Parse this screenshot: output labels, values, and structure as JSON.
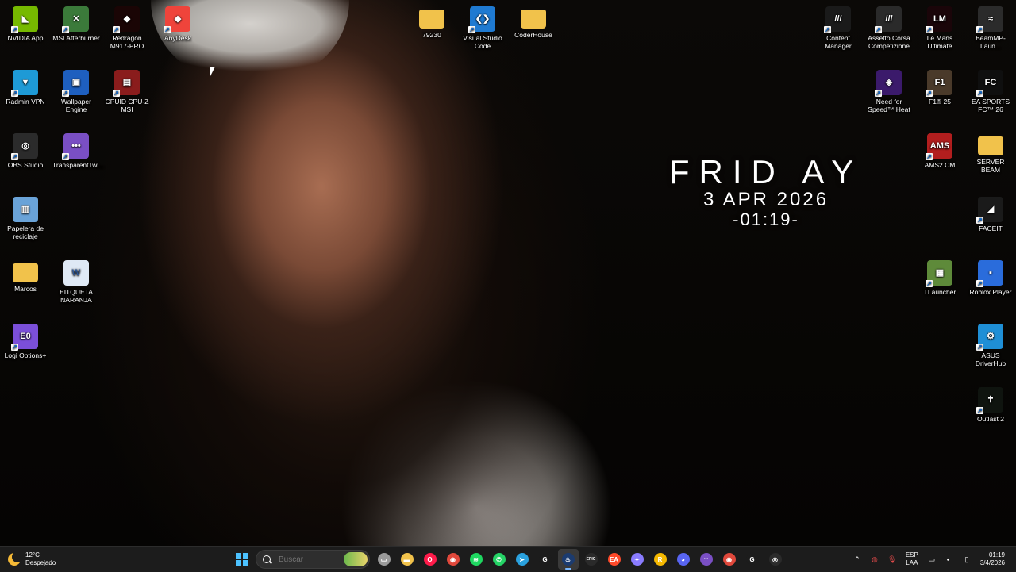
{
  "desktop": {
    "left_icons": [
      {
        "label": "NVIDIA App",
        "icon": "nvidia-icon",
        "color": "#76b900",
        "glyph": "◣"
      },
      {
        "label": "MSI Afterburner",
        "icon": "msi-afterburner-icon",
        "color": "#3b7a3a",
        "glyph": "✕"
      },
      {
        "label": "Redragon M917-PRO",
        "icon": "redragon-icon",
        "color": "#1a0505",
        "glyph": "◆"
      },
      {
        "label": "AnyDesk",
        "icon": "anydesk-icon",
        "color": "#ef443b",
        "glyph": "◆"
      },
      {
        "label": "Radmin VPN",
        "icon": "radmin-vpn-icon",
        "color": "#1e9ad6",
        "glyph": "▼"
      },
      {
        "label": "Wallpaper Engine",
        "icon": "wallpaper-engine-icon",
        "color": "#1e5fbf",
        "glyph": "▣"
      },
      {
        "label": "CPUID CPU-Z MSI",
        "icon": "cpuz-icon",
        "color": "#8a1c1c",
        "glyph": "▤"
      },
      {
        "label": "OBS Studio",
        "icon": "obs-icon",
        "color": "#2b2b2b",
        "glyph": "◎"
      },
      {
        "label": "TransparentTwi...",
        "icon": "transparent-twitch-icon",
        "color": "#7a4fc4",
        "glyph": "•••"
      },
      {
        "label": "Papelera de reciclaje",
        "icon": "recycle-bin-icon",
        "color": "#6aa3d8",
        "glyph": "▥"
      },
      {
        "label": "Marcos",
        "icon": "folder-icon",
        "color": "#f1c24b",
        "glyph": ""
      },
      {
        "label": "EITQUETA NARANJA",
        "icon": "word-document-icon",
        "color": "#dfe9f5",
        "glyph": "W"
      },
      {
        "label": "Logi Options+",
        "icon": "logi-options-icon",
        "color": "#7b4fd9",
        "glyph": "E0"
      }
    ],
    "top_icons": [
      {
        "label": "79230",
        "icon": "folder-icon",
        "color": "#f1c24b",
        "glyph": ""
      },
      {
        "label": "Visual Studio Code",
        "icon": "vscode-icon",
        "color": "#1f7ad1",
        "glyph": "❮❯"
      },
      {
        "label": "CoderHouse",
        "icon": "folder-icon",
        "color": "#f1c24b",
        "glyph": ""
      }
    ],
    "right_icons": [
      {
        "label": "Content Manager",
        "icon": "content-manager-icon",
        "color": "#1a1a1a",
        "glyph": "///"
      },
      {
        "label": "Assetto Corsa Competizione",
        "icon": "acc-icon",
        "color": "#2a2a2a",
        "glyph": "///"
      },
      {
        "label": "Le Mans Ultimate",
        "icon": "le-mans-ultimate-icon",
        "color": "#1a0509",
        "glyph": "LM"
      },
      {
        "label": "BeamMP-Laun...",
        "icon": "beammp-icon",
        "color": "#2b2b2b",
        "glyph": "≈"
      },
      {
        "label": "Need for Speed™ Heat",
        "icon": "nfs-heat-icon",
        "color": "#3b1a6b",
        "glyph": "◈"
      },
      {
        "label": "F1® 25",
        "icon": "f1-25-icon",
        "color": "#4a3a2a",
        "glyph": "F1"
      },
      {
        "label": "EA SPORTS FC™ 26",
        "icon": "ea-fc-26-icon",
        "color": "#0f0f0f",
        "glyph": "FC"
      },
      {
        "label": "AMS2 CM",
        "icon": "ams2-icon",
        "color": "#b21e1e",
        "glyph": "AMS"
      },
      {
        "label": "SERVER BEAM",
        "icon": "folder-icon",
        "color": "#f1c24b",
        "glyph": ""
      },
      {
        "label": "FACEIT",
        "icon": "faceit-icon",
        "color": "#1a1a1a",
        "glyph": "◢"
      },
      {
        "label": "TLauncher",
        "icon": "tlauncher-icon",
        "color": "#5e8a3a",
        "glyph": "▦"
      },
      {
        "label": "Roblox Player",
        "icon": "roblox-icon",
        "color": "#2a6cdb",
        "glyph": "▪"
      },
      {
        "label": "ASUS DriverHub",
        "icon": "asus-driverhub-icon",
        "color": "#1f8fd6",
        "glyph": "⚙"
      },
      {
        "label": "Outlast 2",
        "icon": "outlast-2-icon",
        "color": "#0f140f",
        "glyph": "✝"
      }
    ]
  },
  "clock_widget": {
    "day": "FRID AY",
    "date": "3 APR 2026",
    "time": "-01:19-"
  },
  "taskbar": {
    "weather": {
      "temp": "12°C",
      "condition": "Despejado"
    },
    "search_placeholder": "Buscar",
    "apps": [
      {
        "name": "task-view-icon",
        "color": "#9a9a9a",
        "glyph": "▭"
      },
      {
        "name": "file-explorer-icon",
        "color": "#f1c24b",
        "glyph": "▬"
      },
      {
        "name": "opera-gx-icon",
        "color": "#ff1b4a",
        "glyph": "O"
      },
      {
        "name": "chrome-icon",
        "color": "#e0483b",
        "glyph": "◉"
      },
      {
        "name": "spotify-icon",
        "color": "#1ed760",
        "glyph": "≋"
      },
      {
        "name": "whatsapp-icon",
        "color": "#25d366",
        "glyph": "✆"
      },
      {
        "name": "telegram-icon",
        "color": "#2aa1de",
        "glyph": "➤"
      },
      {
        "name": "g-hub-icon",
        "color": "#1c1c1c",
        "glyph": "G"
      },
      {
        "name": "steam-icon",
        "color": "#1b3b6f",
        "glyph": "♨"
      },
      {
        "name": "epic-games-icon",
        "color": "#2a2a2a",
        "glyph": "EPIC"
      },
      {
        "name": "ea-app-icon",
        "color": "#ff4a2a",
        "glyph": "EA"
      },
      {
        "name": "game-controller-icon",
        "color": "#8a7cff",
        "glyph": "✦"
      },
      {
        "name": "rockstar-icon",
        "color": "#f5b800",
        "glyph": "R"
      },
      {
        "name": "discord-icon",
        "color": "#5865f2",
        "glyph": "◕"
      },
      {
        "name": "twitch-helper-icon",
        "color": "#7a4fc4",
        "glyph": "•••"
      },
      {
        "name": "chrome-profile-icon",
        "color": "#e0483b",
        "glyph": "◉"
      },
      {
        "name": "g-hub-2-icon",
        "color": "#1c1c1c",
        "glyph": "G"
      },
      {
        "name": "obs-studio-icon",
        "color": "#2b2b2b",
        "glyph": "◎"
      }
    ],
    "tray": {
      "language": "ESP",
      "layout": "LAA",
      "time": "01:19",
      "date": "3/4/2026"
    }
  }
}
